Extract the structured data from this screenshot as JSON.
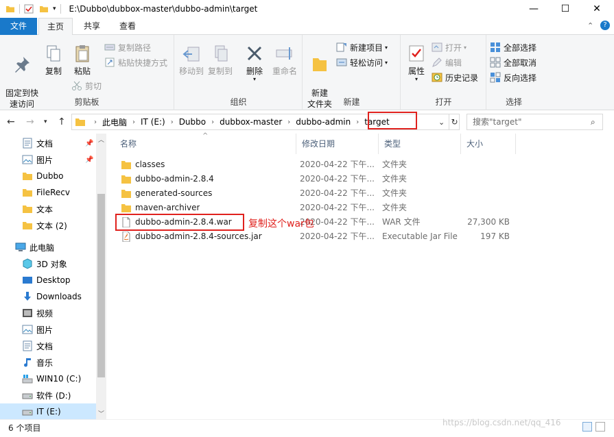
{
  "window": {
    "title_path": "E:\\Dubbo\\dubbox-master\\dubbo-admin\\target",
    "minimize": "—",
    "maximize": "☐",
    "close": "✕"
  },
  "ribbon_tabs": [
    "文件",
    "主页",
    "共享",
    "查看"
  ],
  "ribbon": {
    "clipboard": {
      "label": "剪贴板",
      "pin": "固定到快\n速访问",
      "copy": "复制",
      "paste": "粘贴",
      "copy_path": "复制路径",
      "paste_shortcut": "粘贴快捷方式",
      "cut": "剪切"
    },
    "organize": {
      "label": "组织",
      "move_to": "移动到",
      "copy_to": "复制到",
      "delete": "删除",
      "rename": "重命名"
    },
    "new": {
      "label": "新建",
      "new_folder": "新建\n文件夹",
      "new_item": "新建项目",
      "easy_access": "轻松访问"
    },
    "open": {
      "label": "打开",
      "properties": "属性",
      "open": "打开",
      "edit": "编辑",
      "history": "历史记录"
    },
    "select": {
      "label": "选择",
      "select_all": "全部选择",
      "select_none": "全部取消",
      "invert": "反向选择"
    }
  },
  "address": {
    "crumbs": [
      "此电脑",
      "IT (E:)",
      "Dubbo",
      "dubbox-master",
      "dubbo-admin",
      "target"
    ],
    "search_placeholder": "搜索\"target\""
  },
  "nav": {
    "quick": [
      "文档",
      "图片",
      "Dubbo",
      "FileRecv",
      "文本",
      "文本 (2)"
    ],
    "this_pc": "此电脑",
    "pc_items": [
      "3D 对象",
      "Desktop",
      "Downloads",
      "视频",
      "图片",
      "文档",
      "音乐",
      "WIN10 (C:)",
      "软件 (D:)",
      "IT (E:)"
    ]
  },
  "columns": [
    "名称",
    "修改日期",
    "类型",
    "大小"
  ],
  "files": [
    {
      "name": "classes",
      "date": "2020-04-22 下午...",
      "type": "文件夹",
      "size": "",
      "kind": "folder"
    },
    {
      "name": "dubbo-admin-2.8.4",
      "date": "2020-04-22 下午...",
      "type": "文件夹",
      "size": "",
      "kind": "folder"
    },
    {
      "name": "generated-sources",
      "date": "2020-04-22 下午...",
      "type": "文件夹",
      "size": "",
      "kind": "folder"
    },
    {
      "name": "maven-archiver",
      "date": "2020-04-22 下午...",
      "type": "文件夹",
      "size": "",
      "kind": "folder"
    },
    {
      "name": "dubbo-admin-2.8.4.war",
      "date": "2020-04-22 下午...",
      "type": "WAR 文件",
      "size": "27,300 KB",
      "kind": "file"
    },
    {
      "name": "dubbo-admin-2.8.4-sources.jar",
      "date": "2020-04-22 下午...",
      "type": "Executable Jar File",
      "size": "197 KB",
      "kind": "jar"
    }
  ],
  "annotation": "复制这个war包",
  "status": "6 个项目",
  "watermark": "https://blog.csdn.net/qq_416",
  "colors": {
    "accent": "#1979ca",
    "folder": "#f5c242",
    "annotation": "#e0211d"
  }
}
